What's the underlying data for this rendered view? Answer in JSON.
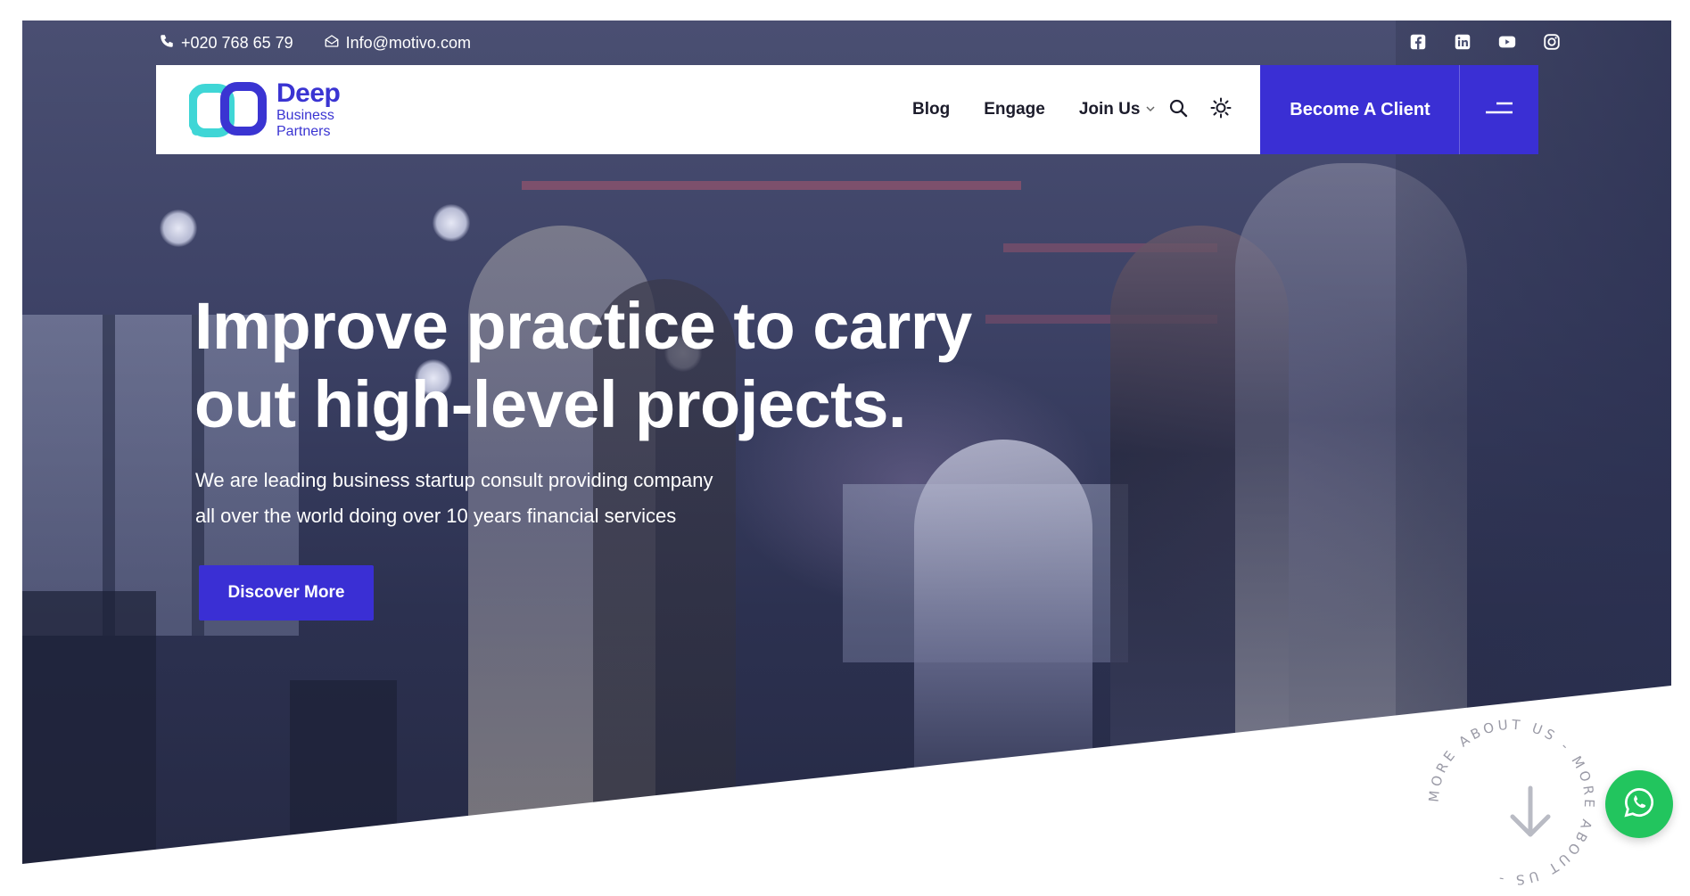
{
  "topbar": {
    "phone": "+020 768 65 79",
    "email": "Info@motivo.com"
  },
  "social": {
    "icons": [
      "facebook-icon",
      "linkedin-icon",
      "youtube-icon",
      "instagram-icon"
    ]
  },
  "logo": {
    "title": "Deep",
    "line1": "Business",
    "line2": "Partners"
  },
  "nav": {
    "items": [
      {
        "label": "Blog"
      },
      {
        "label": "Engage"
      },
      {
        "label": "Join Us"
      }
    ],
    "cta_label": "Become A Client"
  },
  "hero": {
    "headline_line1": "Improve practice to carry",
    "headline_line2": "out high-level projects.",
    "sub_line1": "We are leading business startup consult providing company",
    "sub_line2": "all over the world doing over 10 years financial services",
    "button_label": "Discover More"
  },
  "about": {
    "circle_text": "MORE ABOUT US - MORE ABOUT US - "
  },
  "colors": {
    "brand": "#3a2fd4",
    "logo_cyan": "#3fd6d6",
    "whatsapp": "#22c55e"
  }
}
